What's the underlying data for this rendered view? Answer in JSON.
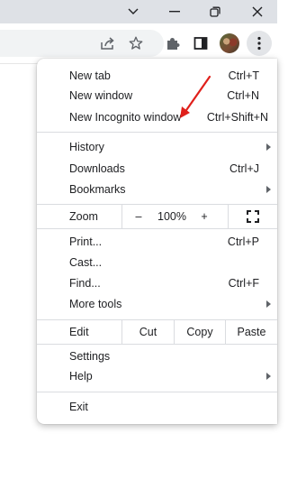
{
  "menu": {
    "new_tab": {
      "label": "New tab",
      "shortcut": "Ctrl+T"
    },
    "new_window": {
      "label": "New window",
      "shortcut": "Ctrl+N"
    },
    "new_incognito": {
      "label": "New Incognito window",
      "shortcut": "Ctrl+Shift+N"
    },
    "history": {
      "label": "History"
    },
    "downloads": {
      "label": "Downloads",
      "shortcut": "Ctrl+J"
    },
    "bookmarks": {
      "label": "Bookmarks"
    },
    "zoom": {
      "label": "Zoom",
      "minus": "–",
      "level": "100%",
      "plus": "+"
    },
    "print": {
      "label": "Print...",
      "shortcut": "Ctrl+P"
    },
    "cast": {
      "label": "Cast..."
    },
    "find": {
      "label": "Find...",
      "shortcut": "Ctrl+F"
    },
    "more_tools": {
      "label": "More tools"
    },
    "edit": {
      "label": "Edit",
      "cut": "Cut",
      "copy": "Copy",
      "paste": "Paste"
    },
    "settings": {
      "label": "Settings"
    },
    "help": {
      "label": "Help"
    },
    "exit": {
      "label": "Exit"
    }
  },
  "icons": {
    "minimize": "chevron-down-icon",
    "restore": "restore-icon",
    "close": "close-icon",
    "share": "share-icon",
    "star": "star-icon",
    "extensions": "puzzle-icon",
    "sidepanel": "side-panel-icon",
    "menu": "three-dot-menu-icon",
    "fullscreen": "fullscreen-icon"
  },
  "colors": {
    "annotation_arrow": "#e0201b",
    "titlebar": "#dee1e6",
    "menu_bg": "#ffffff"
  }
}
